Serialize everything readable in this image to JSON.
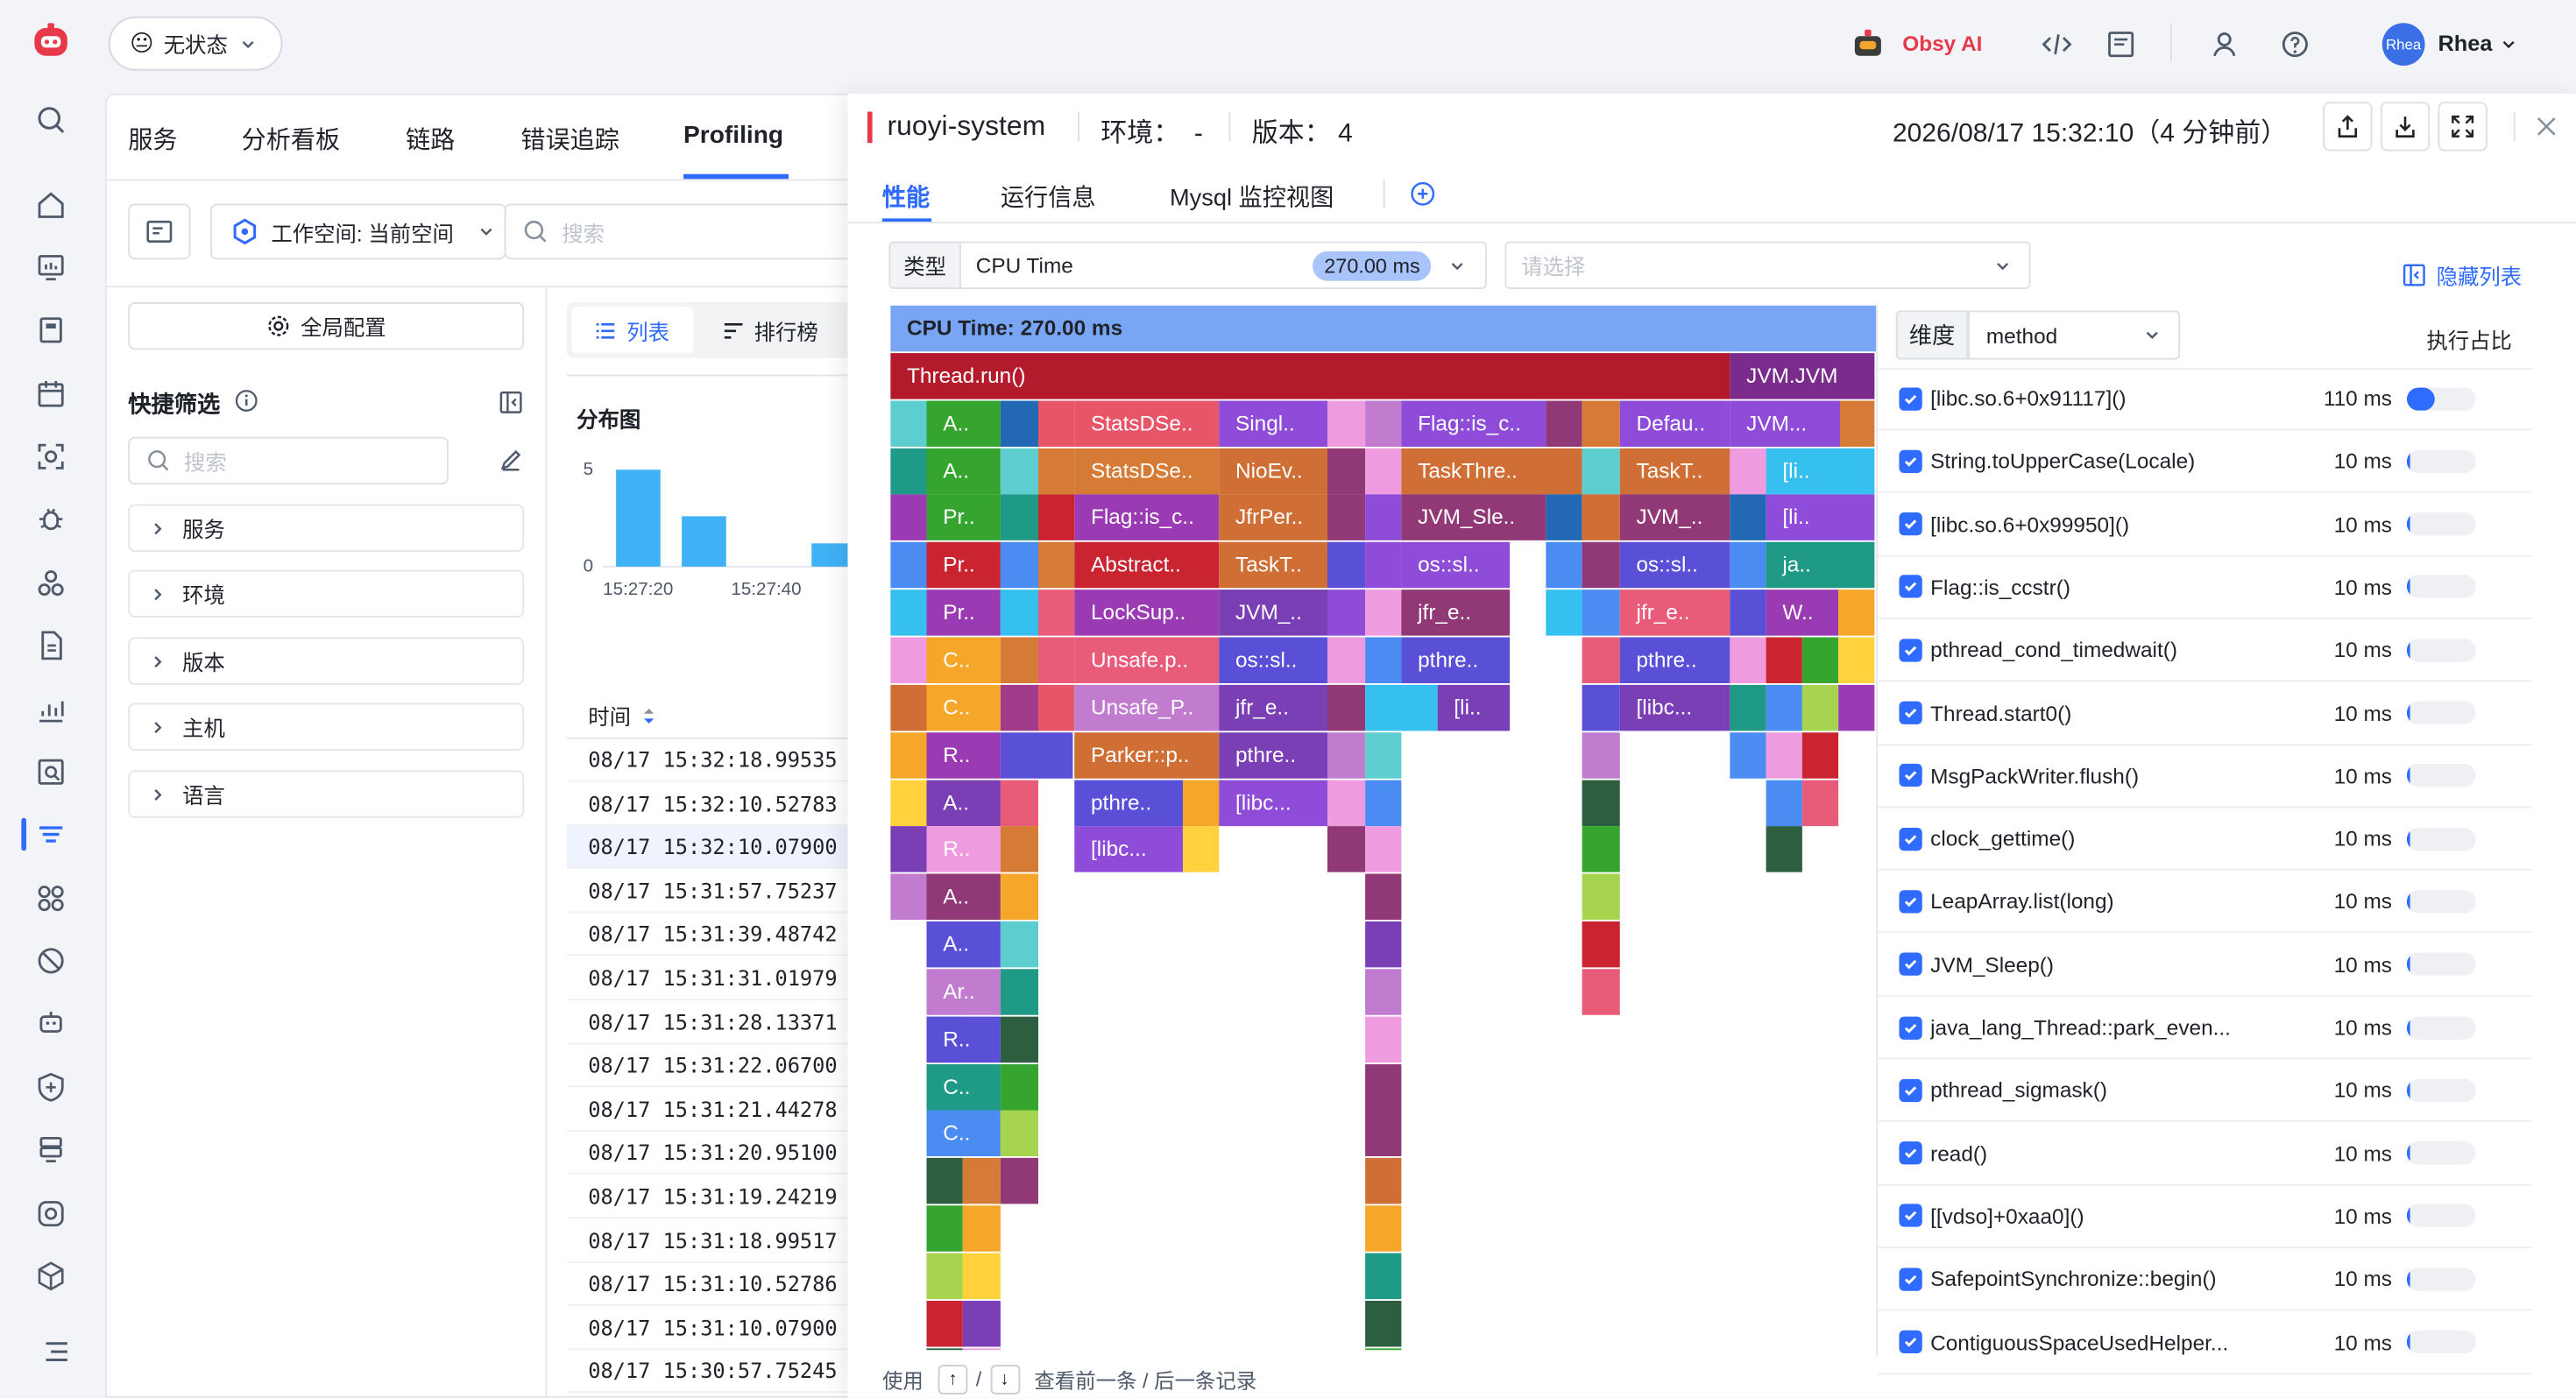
{
  "app": {
    "status_label": "无状态",
    "ai_label": "Obsy AI",
    "user_name": "Rhea",
    "avatar_text": "Rhea"
  },
  "rail_icons": [
    "logo-icon",
    "search-icon",
    "home-icon",
    "dashboard-icon",
    "book-icon",
    "calendar-icon",
    "scan-icon",
    "bug-icon",
    "cluster-icon",
    "document-icon",
    "chart-icon",
    "search-doc-icon",
    "profiling-icon",
    "apps-icon",
    "disabled-icon",
    "robot-icon",
    "shield-icon",
    "database-icon",
    "camera-icon",
    "box-icon",
    "menu-icon"
  ],
  "main": {
    "tabs": [
      "服务",
      "分析看板",
      "链路",
      "错误追踪",
      "Profiling"
    ],
    "active_tab": "Profiling",
    "workspace_label": "工作空间: 当前空间",
    "search_placeholder": "搜索",
    "global_config": "全局配置",
    "quick_filter_title": "快捷筛选",
    "filter_search_placeholder": "搜索",
    "filters": [
      "服务",
      "环境",
      "版本",
      "主机",
      "语言"
    ],
    "view_list": "列表",
    "view_rank": "排行榜",
    "dist_title": "分布图",
    "dist_y_ticks": [
      "5",
      "0"
    ],
    "dist_x_ticks": [
      "15:27:20",
      "15:27:40"
    ],
    "dist_values": [
      5,
      2.6,
      1.2
    ],
    "time_header": "时间",
    "rows": [
      "08/17 15:32:18.99535",
      "08/17 15:32:10.52783",
      "08/17 15:32:10.07900",
      "08/17 15:31:57.75237",
      "08/17 15:31:39.48742",
      "08/17 15:31:31.01979",
      "08/17 15:31:28.13371",
      "08/17 15:31:22.06700",
      "08/17 15:31:21.44278",
      "08/17 15:31:20.95100",
      "08/17 15:31:19.24219",
      "08/17 15:31:18.99517",
      "08/17 15:31:10.52786",
      "08/17 15:31:10.07900",
      "08/17 15:30:57.75245"
    ],
    "selected_row": 2
  },
  "drawer": {
    "service": "ruoyi-system",
    "env": "环境：  -",
    "version": "版本： 4",
    "timestamp": "2026/08/17 15:32:10（4 分钟前）",
    "tabs": [
      "性能",
      "运行信息",
      "Mysql 监控视图"
    ],
    "active_tab": "性能",
    "type_label": "类型",
    "type_value": "CPU Time",
    "type_badge": "270.00 ms",
    "select_placeholder": "请选择",
    "hide_list": "隐藏列表",
    "footer_use": "使用",
    "footer_up": "↑",
    "footer_down": "↓",
    "footer_hint": "查看前一条 / 后一条记录",
    "dimension_label": "维度",
    "dimension_value": "method",
    "ratio_label": "执行占比"
  },
  "colors": {
    "accent": "#2f6bff",
    "root_bar": "#78a6f5",
    "thread_bar": "#b31b2c"
  },
  "flame_labels": {
    "root": "CPU Time: 270.00 ms",
    "thread": "Thread.run()",
    "jvm": "JVM.JVM",
    "l2": [
      "A..",
      "StatsDSe..",
      "Singl..",
      "Flag::is_c..",
      "Defau..",
      "JVM..."
    ],
    "l3": [
      "A..",
      "StatsDSe..",
      "NioEv..",
      "TaskThre..",
      "TaskT..",
      "[li.."
    ],
    "l4": [
      "Pr..",
      "Flag::is_c..",
      "JfrPer..",
      "JVM_Sle..",
      "JVM_..",
      "[li.."
    ],
    "l5": [
      "Pr..",
      "Abstract..",
      "TaskT..",
      "os::sl..",
      "os::sl..",
      "ja.."
    ],
    "l6": [
      "Pr..",
      "LockSup..",
      "JVM_..",
      "jfr_e..",
      "jfr_e..",
      "W.."
    ],
    "l7": [
      "C..",
      "Unsafe.p..",
      "os::sl..",
      "pthre..",
      "pthre.."
    ],
    "l8": [
      "C..",
      "Unsafe_P..",
      "jfr_e..",
      "[li..",
      "[libc..."
    ],
    "l9": [
      "R..",
      "Parker::p..",
      "pthre.."
    ],
    "l10": [
      "A..",
      "pthre..",
      "[libc..."
    ],
    "l11": [
      "R..",
      "[libc..."
    ],
    "l12": [
      "A.."
    ],
    "l13": [
      "A.."
    ],
    "l14": [
      "Ar.."
    ],
    "l15": [
      "R.."
    ],
    "l16": [
      "C.."
    ],
    "l17": [
      "C.."
    ]
  },
  "methods": [
    {
      "name": "[libc.so.6+0x91117]()",
      "value": "110 ms",
      "ratio": 0.41
    },
    {
      "name": "String.toUpperCase(Locale)",
      "value": "10 ms",
      "ratio": 0.037
    },
    {
      "name": "[libc.so.6+0x99950]()",
      "value": "10 ms",
      "ratio": 0.037
    },
    {
      "name": "Flag::is_ccstr()",
      "value": "10 ms",
      "ratio": 0.037
    },
    {
      "name": "pthread_cond_timedwait()",
      "value": "10 ms",
      "ratio": 0.037
    },
    {
      "name": "Thread.start0()",
      "value": "10 ms",
      "ratio": 0.037
    },
    {
      "name": "MsgPackWriter.flush()",
      "value": "10 ms",
      "ratio": 0.037
    },
    {
      "name": "clock_gettime()",
      "value": "10 ms",
      "ratio": 0.037
    },
    {
      "name": "LeapArray.list(long)",
      "value": "10 ms",
      "ratio": 0.037
    },
    {
      "name": "JVM_Sleep()",
      "value": "10 ms",
      "ratio": 0.037
    },
    {
      "name": "java_lang_Thread::park_even...",
      "value": "10 ms",
      "ratio": 0.037
    },
    {
      "name": "pthread_sigmask()",
      "value": "10 ms",
      "ratio": 0.037
    },
    {
      "name": "read()",
      "value": "10 ms",
      "ratio": 0.037
    },
    {
      "name": "[[vdso]+0xaa0]()",
      "value": "10 ms",
      "ratio": 0.037
    },
    {
      "name": "SafepointSynchronize::begin()",
      "value": "10 ms",
      "ratio": 0.037
    },
    {
      "name": "ContiguousSpaceUsedHelper...",
      "value": "10 ms",
      "ratio": 0.037
    }
  ]
}
